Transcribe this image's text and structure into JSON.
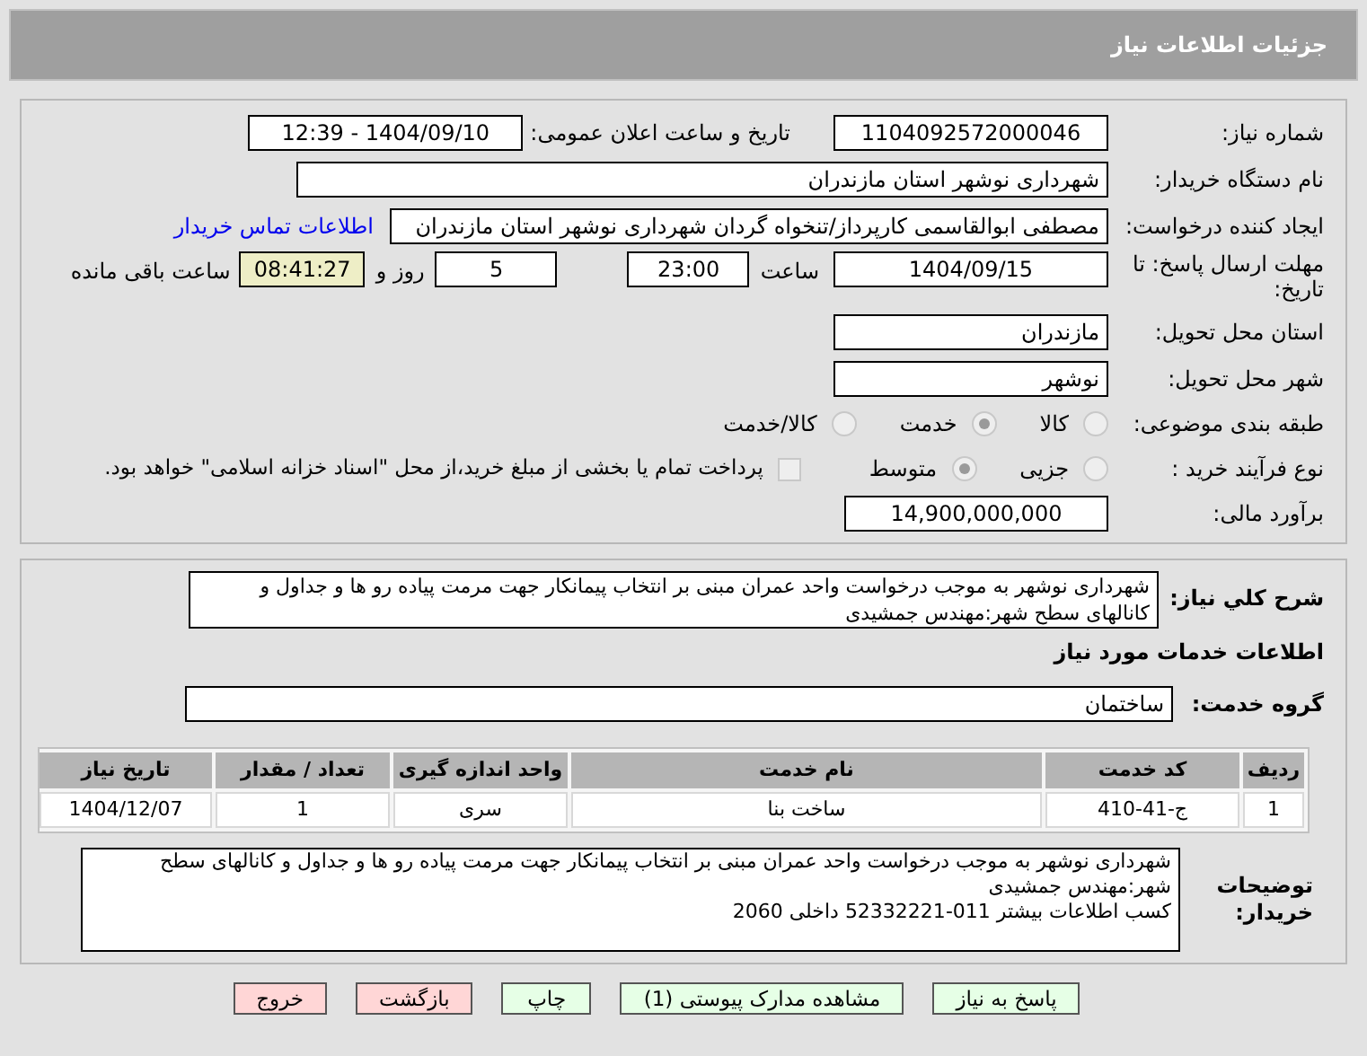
{
  "header": {
    "title": "جزئیات اطلاعات نیاز"
  },
  "fields": {
    "need_number_label": "شماره نیاز:",
    "need_number": "1104092572000046",
    "announce_label": "تاریخ و ساعت اعلان عمومی:",
    "announce_value": "1404/09/10 - 12:39",
    "buyer_label": "نام دستگاه خریدار:",
    "buyer": "شهرداری نوشهر استان مازندران",
    "creator_label": "ایجاد کننده درخواست:",
    "creator": "مصطفی  ابوالقاسمی کارپرداز/تنخواه گردان شهرداری نوشهر استان مازندران",
    "contact_link": "اطلاعات تماس خریدار",
    "deadline_label": "مهلت ارسال پاسخ: تا تاریخ:",
    "deadline_date": "1404/09/15",
    "time_label": "ساعت",
    "deadline_time": "23:00",
    "days": "5",
    "days_label": "روز و",
    "remaining": "08:41:27",
    "remaining_label": "ساعت باقی مانده",
    "province_label": "استان محل تحویل:",
    "province": "مازندران",
    "city_label": "شهر محل تحویل:",
    "city": "نوشهر",
    "category_label": "طبقه بندی موضوعی:",
    "category_options": [
      {
        "label": "کالا",
        "selected": false
      },
      {
        "label": "خدمت",
        "selected": true
      },
      {
        "label": "کالا/خدمت",
        "selected": false
      }
    ],
    "process_label": "نوع فرآیند خرید :",
    "process_options": [
      {
        "label": "جزیی",
        "selected": false
      },
      {
        "label": "متوسط",
        "selected": true
      }
    ],
    "treasury": {
      "checked": false,
      "label": "پرداخت تمام یا بخشی از مبلغ خرید،از محل \"اسناد خزانه اسلامی\" خواهد بود."
    },
    "estimate_label": "برآورد مالی:",
    "estimate": "14,900,000,000"
  },
  "summary": {
    "label": "شرح کلي نياز:",
    "text": "شهرداری نوشهر به موجب درخواست واحد عمران مبنی بر انتخاب پیمانکار جهت مرمت پیاده رو ها و جداول و کانالهای سطح شهر:مهندس جمشیدی"
  },
  "services": {
    "title": "اطلاعات خدمات مورد نیاز",
    "group_label": "گروه خدمت:",
    "group": "ساختمان",
    "columns": [
      "ردیف",
      "کد خدمت",
      "نام خدمت",
      "واحد اندازه گیری",
      "تعداد / مقدار",
      "تاریخ نیاز"
    ],
    "rows": [
      [
        "1",
        "ج-41-410",
        "ساخت بنا",
        "سری",
        "1",
        "1404/12/07"
      ]
    ]
  },
  "buyer_notes": {
    "label": "توضیحات خریدار:",
    "lines": [
      "شهرداری نوشهر به موجب درخواست واحد عمران مبنی بر انتخاب پیمانکار جهت مرمت پیاده رو ها و جداول و کانالهای سطح شهر:مهندس جمشیدی",
      "کسب اطلاعات بیشتر 011-52332221 داخلی 2060"
    ]
  },
  "buttons": [
    {
      "label": "پاسخ به نیاز",
      "kind": "normal"
    },
    {
      "label": "مشاهده مدارک پیوستی (1)",
      "kind": "normal"
    },
    {
      "label": "چاپ",
      "kind": "normal"
    },
    {
      "label": "بازگشت",
      "kind": "danger"
    },
    {
      "label": "خروج",
      "kind": "danger"
    }
  ]
}
